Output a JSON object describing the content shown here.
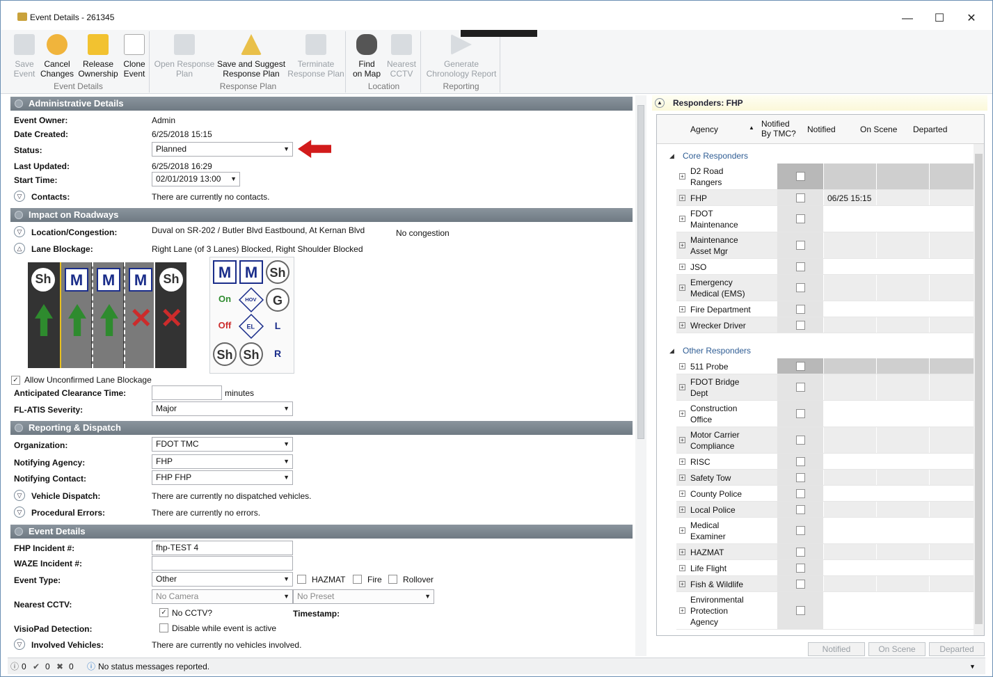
{
  "window": {
    "title": "Event Details - 261345",
    "min": "—",
    "max": "☐",
    "close": "✕"
  },
  "ribbon": {
    "event_details": {
      "label": "Event Details",
      "save": "Save\nEvent",
      "cancel": "Cancel\nChanges",
      "release": "Release\nOwnership",
      "clone": "Clone\nEvent"
    },
    "response_plan": {
      "label": "Response Plan",
      "open": "Open Response\nPlan",
      "suggest": "Save and Suggest\nResponse Plan",
      "terminate": "Terminate\nResponse Plan"
    },
    "location": {
      "label": "Location",
      "find": "Find\non Map",
      "nearest": "Nearest\nCCTV"
    },
    "reporting": {
      "label": "Reporting",
      "generate": "Generate\nChronology Report"
    }
  },
  "admin": {
    "header": "Administrative Details",
    "owner_label": "Event Owner:",
    "owner": "Admin",
    "created_label": "Date Created:",
    "created": "6/25/2018 15:15",
    "status_label": "Status:",
    "status": "Planned",
    "updated_label": "Last Updated:",
    "updated": "6/25/2018 16:29",
    "start_label": "Start Time:",
    "start": "02/01/2019 13:00",
    "contacts_label": "Contacts:",
    "contacts": "There are currently no contacts."
  },
  "impact": {
    "header": "Impact on Roadways",
    "location_label": "Location/Congestion:",
    "location": "Duval on SR-202 / Butler Blvd Eastbound, At Kernan Blvd",
    "congestion": "No congestion",
    "lane_label": "Lane Blockage:",
    "lane": "Right Lane (of 3 Lanes) Blocked, Right Shoulder Blocked",
    "lanes": [
      {
        "badge": "Sh",
        "type": "shoulder",
        "state": "open"
      },
      {
        "badge": "M",
        "type": "main",
        "state": "open"
      },
      {
        "badge": "M",
        "type": "main",
        "state": "open"
      },
      {
        "badge": "M",
        "type": "main",
        "state": "blocked"
      },
      {
        "badge": "Sh",
        "type": "shoulder",
        "state": "blocked"
      }
    ],
    "palette": [
      "M",
      "M",
      "Sh",
      "On",
      "HOV",
      "G",
      "Off",
      "EL",
      "L",
      "Sh",
      "Sh",
      "R"
    ],
    "allow_unconfirmed": "Allow Unconfirmed Lane Blockage",
    "clearance_label": "Anticipated Clearance Time:",
    "clearance_value": "",
    "minutes": "minutes",
    "severity_label": "FL-ATIS Severity:",
    "severity": "Major"
  },
  "reporting": {
    "header": "Reporting & Dispatch",
    "org_label": "Organization:",
    "org": "FDOT TMC",
    "agency_label": "Notifying Agency:",
    "agency": "FHP",
    "contact_label": "Notifying Contact:",
    "contact": "FHP FHP",
    "dispatch_label": "Vehicle Dispatch:",
    "dispatch": "There are currently no dispatched vehicles.",
    "errors_label": "Procedural Errors:",
    "errors": "There are currently no errors."
  },
  "event": {
    "header": "Event Details",
    "fhp_label": "FHP Incident #:",
    "fhp": "fhp-TEST 4",
    "waze_label": "WAZE Incident #:",
    "waze": "",
    "type_label": "Event Type:",
    "type": "Other",
    "hazmat": "HAZMAT",
    "fire": "Fire",
    "rollover": "Rollover",
    "cctv_label": "Nearest CCTV:",
    "camera": "No Camera",
    "preset": "No Preset",
    "no_cctv": "No CCTV?",
    "timestamp": "Timestamp:",
    "visio_label": "VisioPad Detection:",
    "visio": "Disable while event is active",
    "vehicles_label": "Involved Vehicles:",
    "vehicles": "There are currently no vehicles involved."
  },
  "responders": {
    "title": "Responders:  FHP",
    "columns": {
      "agency": "Agency",
      "notified_tmc": "Notified\nBy TMC?",
      "notified": "Notified",
      "on_scene": "On Scene",
      "departed": "Departed"
    },
    "core_label": "Core Responders",
    "core": [
      {
        "name": "D2 Road\nRangers",
        "notified": ""
      },
      {
        "name": "FHP",
        "notified": "06/25 15:15"
      },
      {
        "name": "FDOT\nMaintenance",
        "notified": ""
      },
      {
        "name": "Maintenance\nAsset Mgr",
        "notified": ""
      },
      {
        "name": "JSO",
        "notified": ""
      },
      {
        "name": "Emergency\nMedical (EMS)",
        "notified": ""
      },
      {
        "name": "Fire Department",
        "notified": ""
      },
      {
        "name": "Wrecker Driver",
        "notified": ""
      }
    ],
    "other_label": "Other Responders",
    "other": [
      {
        "name": "511 Probe"
      },
      {
        "name": "FDOT Bridge\nDept"
      },
      {
        "name": "Construction\nOffice"
      },
      {
        "name": "Motor Carrier\nCompliance"
      },
      {
        "name": "RISC"
      },
      {
        "name": "Safety Tow"
      },
      {
        "name": "County Police"
      },
      {
        "name": "Local Police"
      },
      {
        "name": "Medical\nExaminer"
      },
      {
        "name": "HAZMAT"
      },
      {
        "name": "Life Flight"
      },
      {
        "name": "Fish & Wildlife"
      },
      {
        "name": "Environmental\nProtection\nAgency"
      }
    ],
    "btn_notified": "Notified",
    "btn_onscene": "On Scene",
    "btn_departed": "Departed"
  },
  "status": {
    "info": "0",
    "ok": "0",
    "err": "0",
    "message": "No status messages reported."
  }
}
